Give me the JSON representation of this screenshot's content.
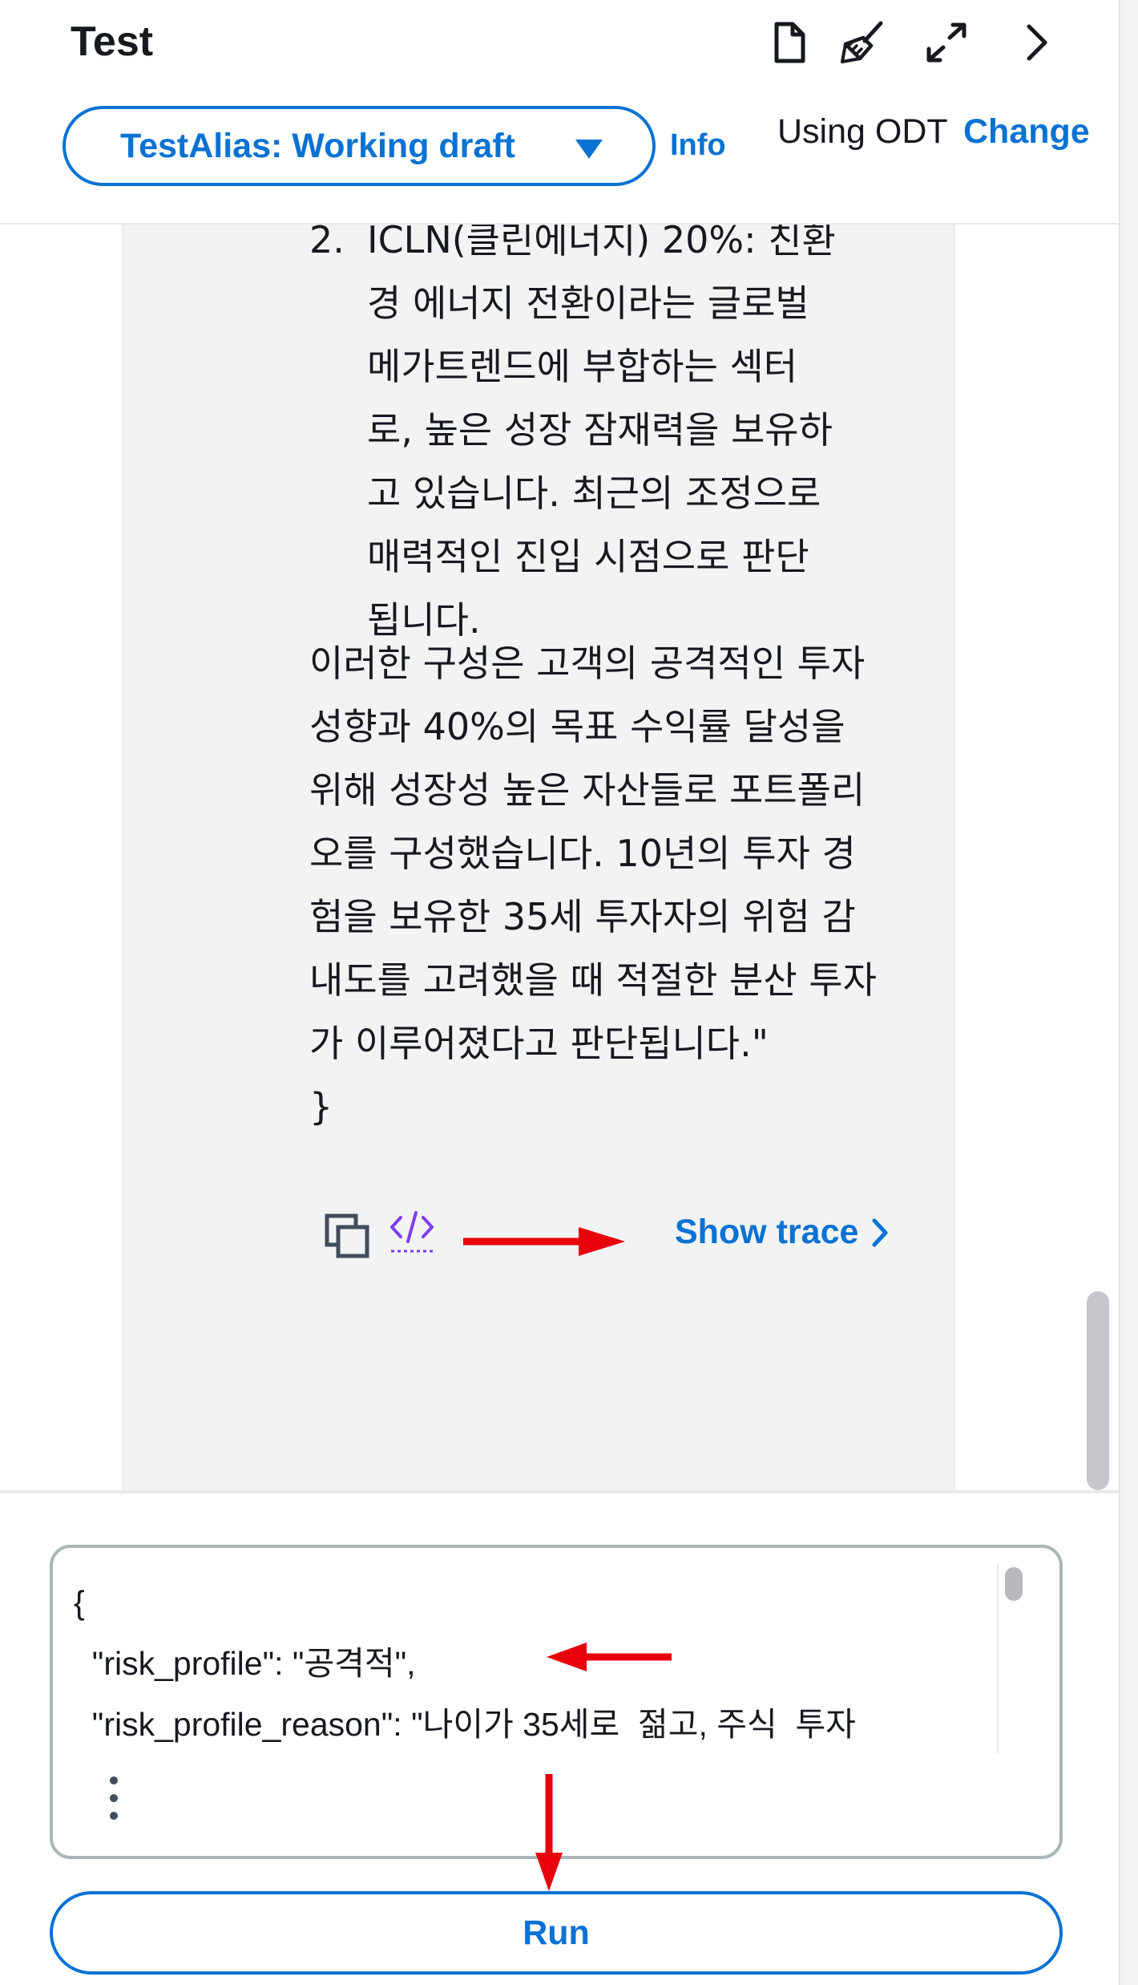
{
  "header": {
    "title": "Test",
    "alias_label": "TestAlias: Working draft",
    "info_label": "Info",
    "odt_label": "Using ODT",
    "change_label": "Change",
    "icons": [
      "document-icon",
      "broom-icon",
      "expand-icon",
      "chevron-right-icon"
    ]
  },
  "message": {
    "list_number": "2.",
    "list_item_lines": [
      "ICLN(클린에너지) 20%: 친환",
      "경 에너지 전환이라는 글로벌",
      "메가트렌드에 부합하는 섹터",
      "로, 높은 성장 잠재력을 보유하",
      "고 있습니다. 최근의 조정으로",
      "매력적인 진입 시점으로 판단",
      "됩니다."
    ],
    "paragraph_lines": [
      "이러한 구성은 고객의 공격적인 투자",
      "성향과 40%의 목표 수익률 달성을",
      "위해 성장성 높은 자산들로 포트폴리",
      "오를 구성했습니다. 10년의 투자 경",
      "험을 보유한 35세 투자자의 위험 감",
      "내도를 고려했을 때 적절한 분산 투자",
      "가 이루어졌다고 판단됩니다.\"",
      "}"
    ],
    "show_trace_label": "Show trace"
  },
  "input": {
    "lines": [
      "{",
      "  \"risk_profile\": \"공격적\",",
      "  \"risk_profile_reason\": \"나이가 35세로  젊고, 주식  투자"
    ]
  },
  "run_label": "Run",
  "colors": {
    "link": "#0972d3",
    "annotation_arrow": "#e8000b",
    "bubble_bg": "#f2f3f3"
  }
}
